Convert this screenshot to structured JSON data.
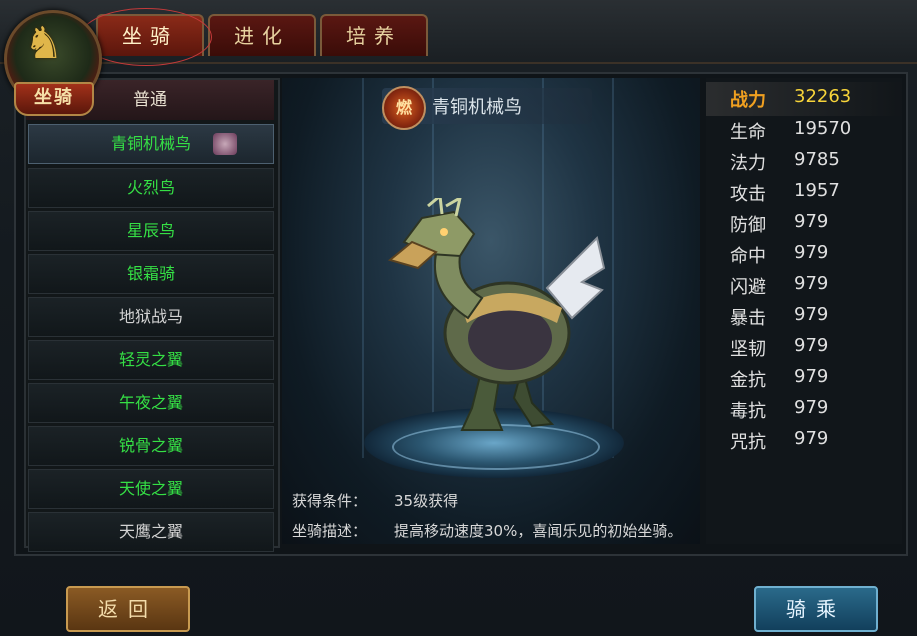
{
  "emblem": {
    "label": "坐骑"
  },
  "tabs": [
    {
      "label": "坐骑",
      "active": true
    },
    {
      "label": "进化",
      "active": false
    },
    {
      "label": "培养",
      "active": false
    }
  ],
  "list": {
    "header": "普通",
    "items": [
      {
        "label": "青铜机械鸟",
        "color": "green",
        "selected": true
      },
      {
        "label": "火烈鸟",
        "color": "green"
      },
      {
        "label": "星辰鸟",
        "color": "green"
      },
      {
        "label": "银霜骑",
        "color": "green"
      },
      {
        "label": "地狱战马",
        "color": "white"
      },
      {
        "label": "轻灵之翼",
        "color": "green"
      },
      {
        "label": "午夜之翼",
        "color": "green"
      },
      {
        "label": "锐骨之翼",
        "color": "green"
      },
      {
        "label": "天使之翼",
        "color": "green"
      },
      {
        "label": "天鹰之翼",
        "color": "white"
      }
    ]
  },
  "stage": {
    "badge": "燃",
    "mount_name": "青铜机械鸟",
    "condition_label": "获得条件：",
    "condition_value": "35级获得",
    "desc_label": "坐骑描述：",
    "desc_value": "提高移动速度30%，喜闻乐见的初始坐骑。"
  },
  "stats": [
    {
      "label": "战力",
      "value": "32263"
    },
    {
      "label": "生命",
      "value": "19570"
    },
    {
      "label": "法力",
      "value": "9785"
    },
    {
      "label": "攻击",
      "value": "1957"
    },
    {
      "label": "防御",
      "value": "979"
    },
    {
      "label": "命中",
      "value": "979"
    },
    {
      "label": "闪避",
      "value": "979"
    },
    {
      "label": "暴击",
      "value": "979"
    },
    {
      "label": "坚韧",
      "value": "979"
    },
    {
      "label": "金抗",
      "value": "979"
    },
    {
      "label": "毒抗",
      "value": "979"
    },
    {
      "label": "咒抗",
      "value": "979"
    }
  ],
  "buttons": {
    "back": "返回",
    "ride": "骑乘"
  },
  "colors": {
    "green_text": "#35e045",
    "power_value": "#f7d43a",
    "tab_red": "#5a1712"
  }
}
